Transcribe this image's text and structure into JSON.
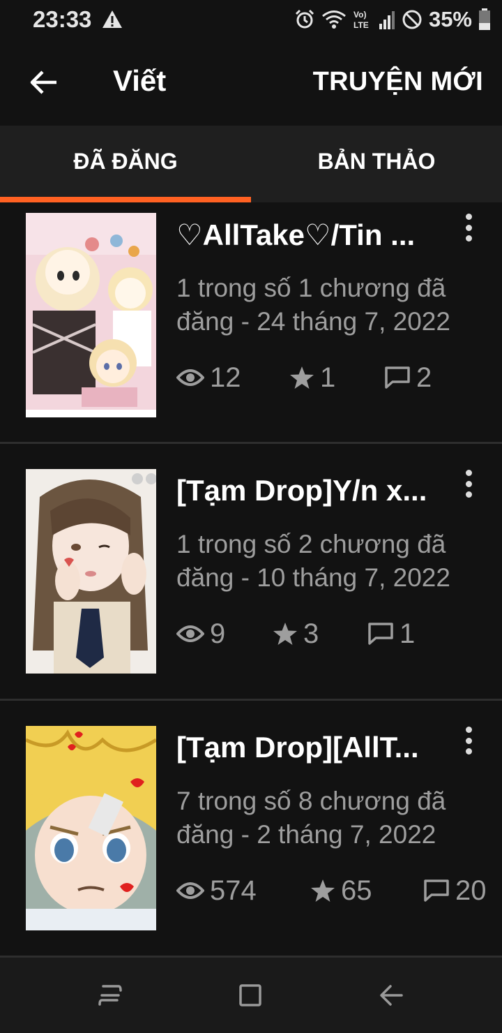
{
  "status_bar": {
    "time": "23:33",
    "battery": "35%",
    "icons": [
      "warning-icon",
      "alarm-icon",
      "wifi-icon",
      "volte-icon",
      "signal-icon",
      "do-not-disturb-icon",
      "battery-icon"
    ]
  },
  "app_bar": {
    "title": "Viết",
    "action": "TRUYỆN MỚI"
  },
  "tabs": [
    {
      "label": "ĐÃ ĐĂNG",
      "selected": true
    },
    {
      "label": "BẢN THẢO",
      "selected": false
    }
  ],
  "colors": {
    "accent": "#ff6122",
    "background": "#121212",
    "tab_bar": "#1f1f1f",
    "secondary_text": "#9e9e9e"
  },
  "stories": [
    {
      "title": "♡AllTake♡/Tin ...",
      "meta_line1": "1 trong số 1 chương đã",
      "meta_line2": "đăng - 24 tháng 7, 2022",
      "views": "12",
      "votes": "1",
      "comments": "2"
    },
    {
      "title": "[Tạm Drop]Y/n x...",
      "meta_line1": "1 trong số 2 chương đã",
      "meta_line2": "đăng - 10 tháng 7, 2022",
      "views": "9",
      "votes": "3",
      "comments": "1"
    },
    {
      "title": "[Tạm Drop][AllT...",
      "meta_line1": "7 trong số 8 chương đã",
      "meta_line2": "đăng - 2 tháng 7, 2022",
      "views": "574",
      "votes": "65",
      "comments": "20"
    }
  ],
  "nav_bar": {
    "buttons": [
      "recent-apps-icon",
      "home-icon",
      "back-icon"
    ]
  }
}
